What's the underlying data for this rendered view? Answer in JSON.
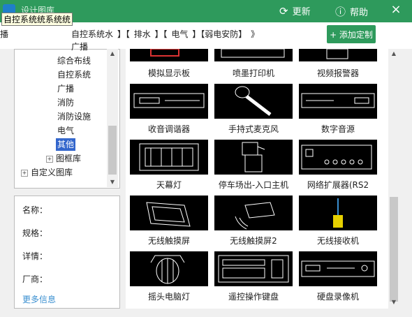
{
  "window": {
    "title": "设计图库",
    "update_label": "更新",
    "help_label": "帮助",
    "close_symbol": "×",
    "tooltip": "自控系统统系统统"
  },
  "toolbar": {
    "left_label": "播",
    "breadcrumb": [
      "自控系统水",
      "】【",
      "排水",
      "】【",
      "电气",
      "】【弱电安防】",
      "》"
    ],
    "add_custom": "+ 添加定制"
  },
  "tree": {
    "top_item": "广播",
    "items": [
      {
        "label": "综合布线"
      },
      {
        "label": "自控系统"
      },
      {
        "label": "广播"
      },
      {
        "label": "消防"
      },
      {
        "label": "消防设施"
      },
      {
        "label": "电气"
      },
      {
        "label": "其他",
        "selected": true
      },
      {
        "label": "图框库",
        "expander": "+"
      },
      {
        "label": "自定义图库",
        "expander": "+"
      }
    ]
  },
  "info": {
    "name_label": "名称：",
    "spec_label": "规格：",
    "detail_label": "详情：",
    "vendor_label": "厂商：",
    "more_link": "更多信息"
  },
  "grid": {
    "rows": [
      [
        "模拟显示板",
        "喷墨打印机",
        "视频报警器"
      ],
      [
        "收音调谐器",
        "手持式麦克风",
        "数字音源"
      ],
      [
        "天幕灯",
        "停车场出-入口主机",
        "网络扩展器(RS2"
      ],
      [
        "无线触摸屏",
        "无线触摸屏2",
        "无线接收机"
      ],
      [
        "摇头电脑灯",
        "遥控操作键盘",
        "硬盘录像机"
      ]
    ]
  },
  "colors": {
    "accent": "#2e9a5c",
    "selection": "#3366cc",
    "link": "#3a8fd0",
    "receiver_highlight": "#e6d000"
  }
}
